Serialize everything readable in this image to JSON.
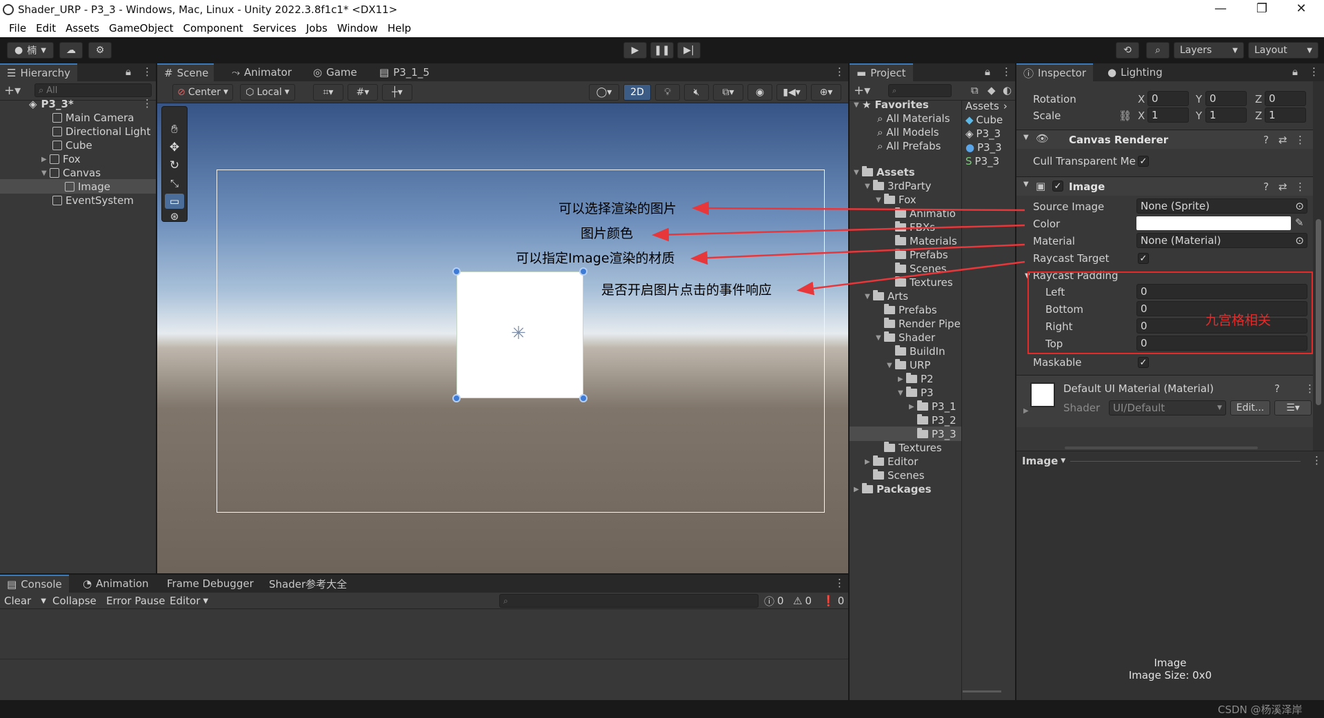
{
  "window": {
    "title": "Shader_URP - P3_3 - Windows, Mac, Linux - Unity 2022.3.8f1c1* <DX11>",
    "controls": [
      "—",
      "❐",
      "✕"
    ]
  },
  "menu": [
    "File",
    "Edit",
    "Assets",
    "GameObject",
    "Component",
    "Services",
    "Jobs",
    "Window",
    "Help"
  ],
  "toolbar": {
    "account_label": "楠",
    "layers_label": "Layers",
    "layout_label": "Layout"
  },
  "hierarchy": {
    "tab": "Hierarchy",
    "search_placeholder": "All",
    "scene": "P3_3*",
    "items": [
      {
        "label": "Main Camera"
      },
      {
        "label": "Directional Light"
      },
      {
        "label": "Cube"
      },
      {
        "label": "Fox"
      },
      {
        "label": "Canvas"
      },
      {
        "label": "Image"
      },
      {
        "label": "EventSystem"
      }
    ]
  },
  "scene_view": {
    "tabs": [
      "Scene",
      "Animator",
      "Game",
      "P3_1_5"
    ],
    "pivot": "Center",
    "space": "Local",
    "mode_2d": "2D",
    "annotations": [
      "可以选择渲染的图片",
      "图片颜色",
      "可以指定Image渲染的材质",
      "是否开启图片点击的事件响应"
    ]
  },
  "console": {
    "tabs": [
      "Console",
      "Animation",
      "Frame Debugger",
      "Shader参考大全"
    ],
    "buttons": [
      "Clear",
      "Collapse",
      "Error Pause",
      "Editor"
    ],
    "counts": [
      "0",
      "0",
      "0"
    ]
  },
  "project": {
    "tab": "Project",
    "favorites_title": "Favorites",
    "favorites": [
      "All Materials",
      "All Models",
      "All Prefabs"
    ],
    "assets_title": "Assets",
    "tree": [
      {
        "label": "3rdParty"
      },
      {
        "label": "Fox"
      },
      {
        "label": "Animatio"
      },
      {
        "label": "FBXs"
      },
      {
        "label": "Materials"
      },
      {
        "label": "Prefabs"
      },
      {
        "label": "Scenes"
      },
      {
        "label": "Textures"
      },
      {
        "label": "Arts"
      },
      {
        "label": "Prefabs"
      },
      {
        "label": "Render Pipe"
      },
      {
        "label": "Shader"
      },
      {
        "label": "BuildIn"
      },
      {
        "label": "URP"
      },
      {
        "label": "P2"
      },
      {
        "label": "P3"
      },
      {
        "label": "P3_1"
      },
      {
        "label": "P3_2"
      },
      {
        "label": "P3_3"
      },
      {
        "label": "Textures"
      },
      {
        "label": "Editor"
      },
      {
        "label": "Scenes"
      }
    ],
    "packages": "Packages",
    "breadcrumb": "Assets",
    "grid_items": [
      "Cube",
      "P3_3",
      "P3_3",
      "P3_3"
    ]
  },
  "inspector": {
    "tabs": [
      "Inspector",
      "Lighting"
    ],
    "rotation": {
      "label": "Rotation",
      "x": "0",
      "y": "0",
      "z": "0"
    },
    "scale": {
      "label": "Scale",
      "x": "1",
      "y": "1",
      "z": "1"
    },
    "canvas_renderer": {
      "title": "Canvas Renderer",
      "cull_label": "Cull Transparent Me"
    },
    "image": {
      "title": "Image",
      "source_label": "Source Image",
      "source_value": "None (Sprite)",
      "color_label": "Color",
      "material_label": "Material",
      "material_value": "None (Material)",
      "raycast_label": "Raycast Target",
      "padding_label": "Raycast Padding",
      "left_label": "Left",
      "left": "0",
      "bottom_label": "Bottom",
      "bottom": "0",
      "right_label": "Right",
      "right": "0",
      "top_label": "Top",
      "top": "0",
      "maskable_label": "Maskable",
      "nine_slice_note": "九宫格相关"
    },
    "material": {
      "title": "Default UI Material (Material)",
      "shader_label": "Shader",
      "shader_value": "UI/Default",
      "edit_label": "Edit..."
    },
    "preview": {
      "dropdown": "Image",
      "name": "Image",
      "size": "Image Size: 0x0"
    }
  },
  "watermark": "CSDN @杨溪泽岸",
  "colors": {
    "accent": "#3a79bb",
    "arrow": "#e8373a",
    "highlight_box": "#e52a2a"
  }
}
